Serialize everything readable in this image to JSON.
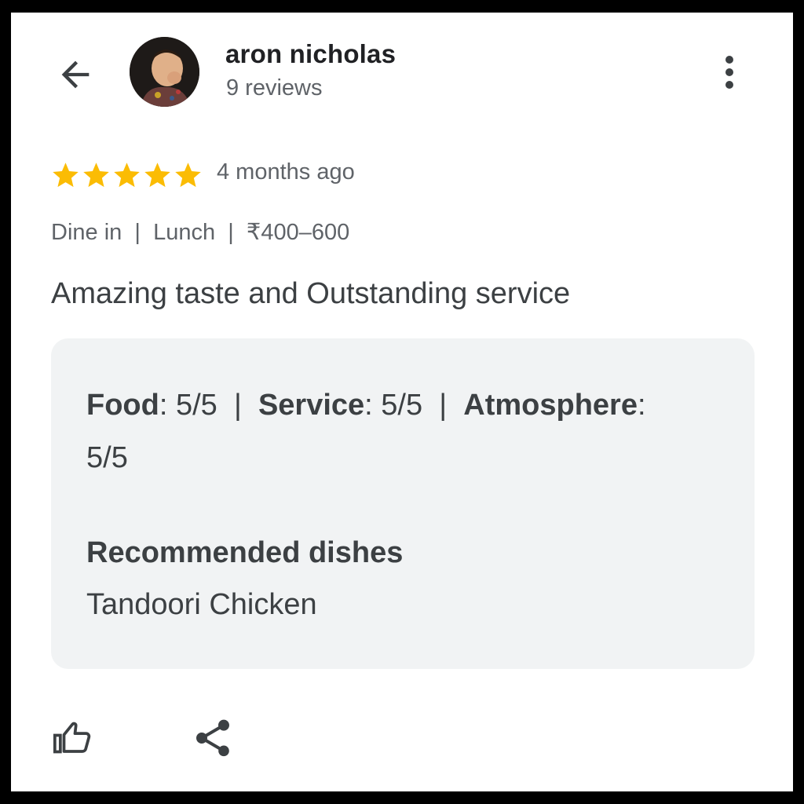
{
  "reviewer": {
    "name": "aron nicholas",
    "review_count": "9 reviews"
  },
  "rating": {
    "stars": 5,
    "max_stars": 5,
    "time_ago": "4 months ago",
    "star_color": "#fbbc04"
  },
  "meta": {
    "dine_type": "Dine in",
    "meal": "Lunch",
    "price_range": "₹400–600",
    "separator": "|"
  },
  "review_text": "Amazing taste and Outstanding service",
  "details": {
    "food_label": "Food",
    "food_value": ": 5/5",
    "service_label": "Service",
    "service_value": ": 5/5",
    "atmosphere_label": "Atmosphere",
    "atmosphere_value": ":",
    "atmosphere_score": "5/5",
    "separator": "|",
    "recommended_title": "Recommended dishes",
    "recommended_dishes": "Tandoori Chicken"
  },
  "icons": {
    "back": "arrow-back-icon",
    "more": "more-vert-icon",
    "like": "thumb-up-icon",
    "share": "share-icon"
  }
}
